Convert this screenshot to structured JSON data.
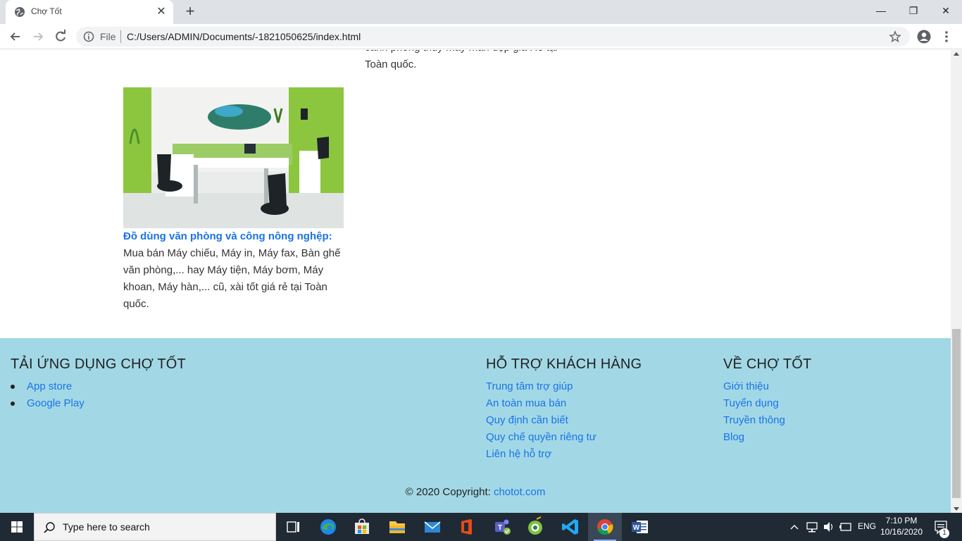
{
  "browser": {
    "tab_title": "Chợ Tốt",
    "file_label": "File",
    "url": "C:/Users/ADMIN/Documents/-1821050625/index.html"
  },
  "content": {
    "top_snippet": "cảnh phong thủy may mắn đẹp giá Rẻ tại Toàn quốc.",
    "card": {
      "title": "Đồ dùng văn phòng và công nông nghệp:",
      "description": " Mua bán Máy chiếu, Máy in, Máy fax, Bàn ghế văn phòng,... hay Máy tiện, Máy bơm, Máy khoan, Máy hàn,... cũ, xài tốt giá rẻ tại Toàn quốc."
    }
  },
  "footer": {
    "app_heading": "TẢI ỨNG DỤNG CHỢ TỐT",
    "app_links": [
      "App store",
      "Google Play"
    ],
    "support_heading": "HỖ TRỢ KHÁCH HÀNG",
    "support_links": [
      "Trung tâm trợ giúp",
      "An toàn mua bán",
      "Quy định cần biết",
      "Quy chế quyền riêng tư",
      "Liên hệ hỗ trợ"
    ],
    "about_heading": "VỀ CHỢ TỐT",
    "about_links": [
      "Giới thiệu",
      "Tuyển dụng",
      "Truyền thông",
      "Blog"
    ],
    "copyright_text": "© 2020 Copyright: ",
    "copyright_link": "chotot.com"
  },
  "taskbar": {
    "search_placeholder": "Type here to search",
    "language": "ENG",
    "time": "7:10 PM",
    "date": "10/16/2020",
    "notification_count": "1"
  },
  "colors": {
    "footer_bg": "#a2d8e6",
    "link": "#1a73e8",
    "taskbar": "#1f2a35"
  }
}
